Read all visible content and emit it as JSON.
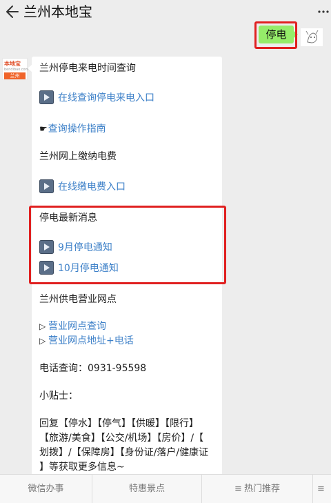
{
  "header": {
    "title": "兰州本地宝"
  },
  "user_message": {
    "text": "停电"
  },
  "bot_avatar": {
    "brand": "本地宝",
    "sub": "bendibao.com",
    "city": "兰州"
  },
  "reply": {
    "line1": "兰州停电来电时间查询",
    "link_query": "在线查询停电来电入口",
    "guide_link": "查询操作指南",
    "line_pay": "兰州网上缴纳电费",
    "link_pay": "在线缴电费入口",
    "line_news": "停电最新消息",
    "link_sep": "9月停电通知",
    "link_oct": "10月停电通知",
    "line_outlets": "兰州供电营业网点",
    "link_outlet_query": "营业网点查询",
    "link_outlet_addr": "营业网点地址+电话",
    "phone": "电话查询：0931-95598",
    "tips_title": "小贴士：",
    "tips_1": "回复【停水】【停气】【供暖】【限行】",
    "tips_2": "【旅游/美食】【公交/机场】【房价】/【",
    "tips_3": "划拨】/【保障房】【身份证/落户/健康证",
    "tips_4": "】等获取更多信息~"
  },
  "bottom_tabs": [
    "微信办事",
    "特惠景点",
    "热门推荐"
  ],
  "colors": {
    "bubble_green": "#95ec69",
    "link_blue": "#3d80c8",
    "highlight_red": "#e02020"
  }
}
